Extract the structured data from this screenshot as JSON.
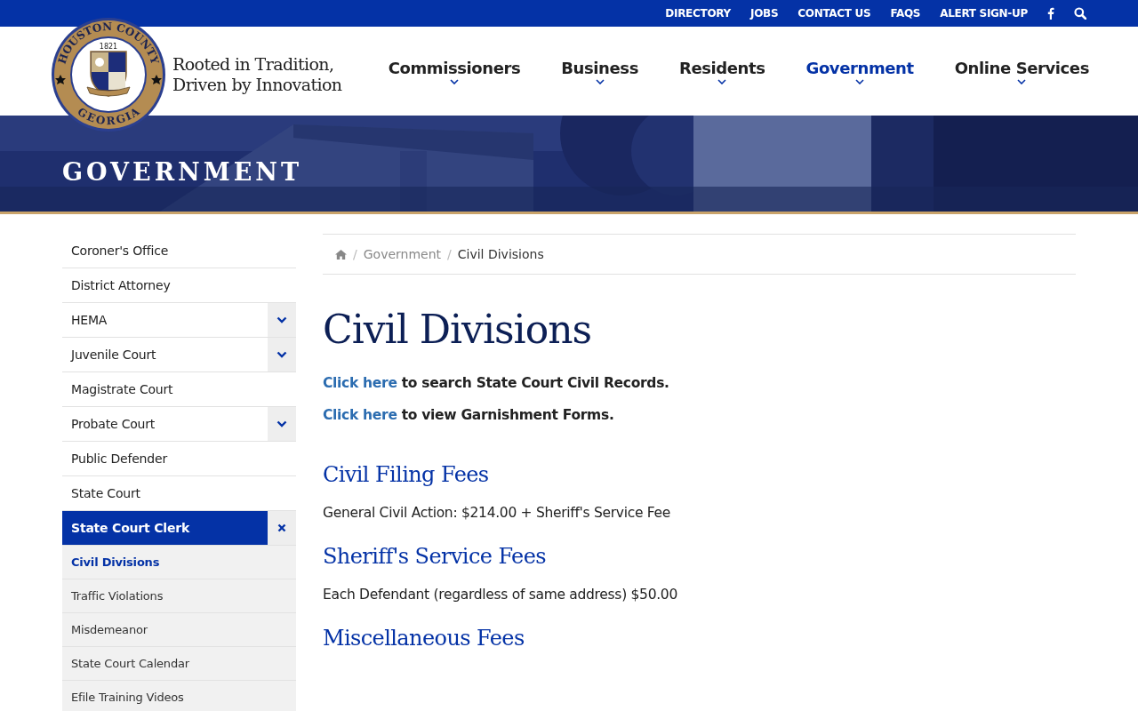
{
  "top_links": [
    "DIRECTORY",
    "JOBS",
    "CONTACT US",
    "FAQS",
    "ALERT SIGN-UP"
  ],
  "logo": {
    "ring_top": "HOUSTON COUNTY",
    "ring_bottom": "GEORGIA",
    "year": "1821",
    "tagline_1": "Rooted in Tradition,",
    "tagline_2": "Driven by Innovation"
  },
  "nav": [
    {
      "label": "Commissioners",
      "selected": false
    },
    {
      "label": "Business",
      "selected": false
    },
    {
      "label": "Residents",
      "selected": false
    },
    {
      "label": "Government",
      "selected": true
    },
    {
      "label": "Online Services",
      "selected": false
    }
  ],
  "hero": {
    "title": "GOVERNMENT"
  },
  "sidebar": [
    {
      "label": "Coroner's Office",
      "selected": false
    },
    {
      "label": "District Attorney",
      "selected": false
    },
    {
      "label": "HEMA",
      "selected": false,
      "expanded": false
    },
    {
      "label": "Juvenile Court",
      "selected": false,
      "expanded": false
    },
    {
      "label": "Magistrate Court",
      "selected": false
    },
    {
      "label": "Probate Court",
      "selected": false,
      "expanded": false
    },
    {
      "label": "Public Defender",
      "selected": false
    },
    {
      "label": "State Court",
      "selected": false
    },
    {
      "label": "State Court Clerk",
      "selected": true,
      "expanded": true,
      "children": [
        {
          "label": "Civil Divisions",
          "selected": true
        },
        {
          "label": "Traffic Violations",
          "selected": false
        },
        {
          "label": "Misdemeanor",
          "selected": false
        },
        {
          "label": "State Court Calendar",
          "selected": false
        },
        {
          "label": "Efile Training Videos",
          "selected": false
        }
      ]
    }
  ],
  "breadcrumb_separator": "/",
  "breadcrumb": [
    "Government",
    "Civil Divisions"
  ],
  "page_title": "Civil Divisions",
  "intro": [
    {
      "link": "Click here",
      "text": "to search State Court Civil Records."
    },
    {
      "link": "Click here",
      "text": "to view Garnishment Forms."
    }
  ],
  "sections": [
    {
      "heading": "Civil Filing Fees",
      "text": "General Civil Action: $214.00 + Sheriff's Service Fee"
    },
    {
      "heading": "Sheriff's Service Fees",
      "text": "Each Defendant (regardless of same address) $50.00"
    },
    {
      "heading": "Miscellaneous Fees"
    }
  ]
}
